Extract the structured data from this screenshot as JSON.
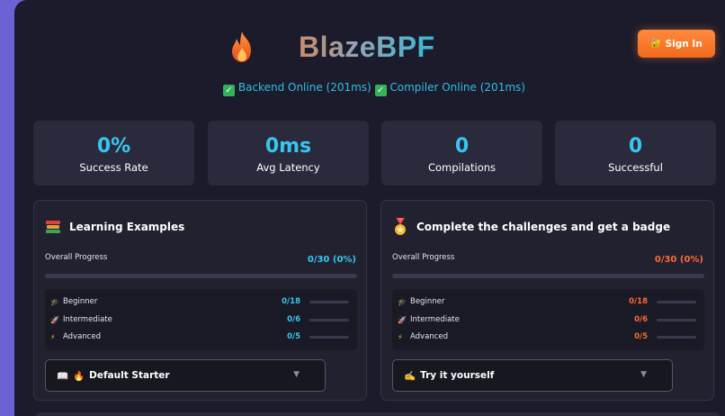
{
  "header": {
    "brand": "BlazeBPF",
    "sign_in_label": "Sign In",
    "sign_in_icon": "key-icon"
  },
  "status": {
    "backend": "Backend Online (201ms)",
    "compiler": "Compiler Online (201ms)"
  },
  "stats": [
    {
      "value": "0%",
      "label": "Success Rate"
    },
    {
      "value": "0ms",
      "label": "Avg Latency"
    },
    {
      "value": "0",
      "label": "Compilations"
    },
    {
      "value": "0",
      "label": "Successful"
    }
  ],
  "learning": {
    "title": "Learning Examples",
    "title_icon": "books-icon",
    "overall_label": "Overall Progress",
    "overall_value": "0/30 (0%)",
    "overall_progress": 0,
    "accent": "#37c6f0",
    "levels": [
      {
        "icon": "graduation-cap-icon",
        "name": "Beginner",
        "count": "0/18",
        "progress": 0
      },
      {
        "icon": "rocket-icon",
        "name": "Intermediate",
        "count": "0/6",
        "progress": 0
      },
      {
        "icon": "lightning-icon",
        "name": "Advanced",
        "count": "0/5",
        "progress": 0
      }
    ],
    "select_value": "Default Starter"
  },
  "challenges": {
    "title": "Complete the challenges and get a badge",
    "title_icon": "medal-icon",
    "overall_label": "Overall Progress",
    "overall_value": "0/30 (0%)",
    "overall_progress": 0,
    "accent": "#ff6a33",
    "levels": [
      {
        "icon": "graduation-cap-icon",
        "name": "Beginner",
        "count": "0/18",
        "progress": 0
      },
      {
        "icon": "rocket-icon",
        "name": "Intermediate",
        "count": "0/6",
        "progress": 0
      },
      {
        "icon": "lightning-icon",
        "name": "Advanced",
        "count": "0/5",
        "progress": 0
      }
    ],
    "select_value": "Try it yourself"
  }
}
